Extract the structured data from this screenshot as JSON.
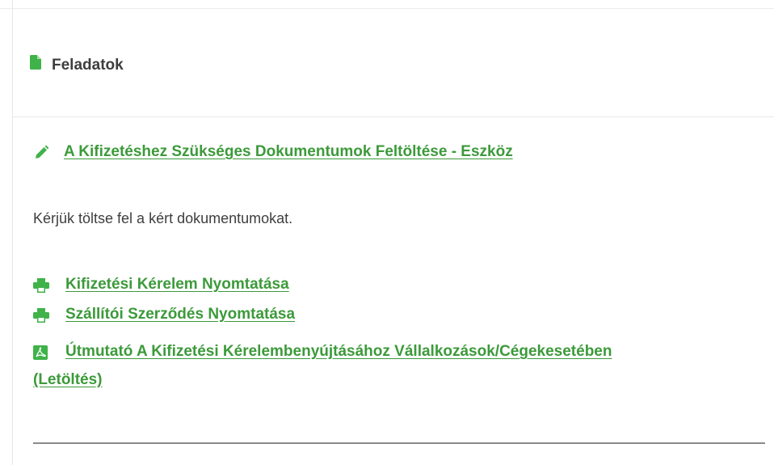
{
  "panel": {
    "title": "Feladatok",
    "header_icon": "document-icon"
  },
  "task": {
    "icon": "pencil-icon",
    "link_label": "A Kifizetéshez Szükséges Dokumentumok Feltöltése - Eszköz",
    "instruction": "Kérjük töltse fel a kért dokumentumokat."
  },
  "documents": [
    {
      "icon": "printer-icon",
      "label": "Kifizetési Kérelem Nyomtatása"
    },
    {
      "icon": "printer-icon",
      "label": "Szállítói Szerződés Nyomtatása"
    },
    {
      "icon": "pdf-icon",
      "label": "Útmutató A Kifizetési Kérelembenyújtásához Vállalkozások/Cégekesetében",
      "label_continued": "(Letöltés)"
    }
  ],
  "colors": {
    "accent_green": "#3c9a3a",
    "icon_green": "#3fb24a",
    "text": "#3e3e3e"
  }
}
